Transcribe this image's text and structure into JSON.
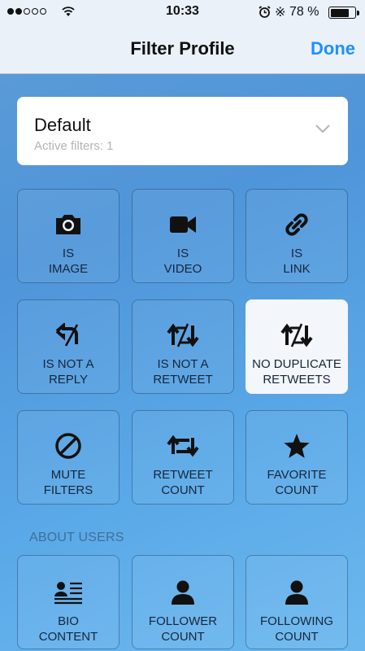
{
  "status_bar": {
    "time": "10:33",
    "battery_percent": "78 %",
    "battery_level": 0.78,
    "signal_bars_filled": 2,
    "signal_bars_total": 5
  },
  "nav": {
    "title": "Filter Profile",
    "done_label": "Done"
  },
  "profile": {
    "name": "Default",
    "subtitle": "Active filters: 1"
  },
  "filters": [
    {
      "id": "image",
      "label": "IS\nIMAGE",
      "icon": "camera-icon",
      "selected": false
    },
    {
      "id": "video",
      "label": "IS\nVIDEO",
      "icon": "video-camera-icon",
      "selected": false
    },
    {
      "id": "link",
      "label": "IS\nLINK",
      "icon": "link-icon",
      "selected": false
    },
    {
      "id": "not-reply",
      "label": "IS NOT A\nREPLY",
      "icon": "reply-crossed-icon",
      "selected": false
    },
    {
      "id": "not-retweet",
      "label": "IS NOT A\nRETWEET",
      "icon": "retweet-crossed-icon",
      "selected": false
    },
    {
      "id": "no-duplicate",
      "label": "NO DUPLICATE\nRETWEETS",
      "icon": "retweet-crossed-icon",
      "selected": true
    },
    {
      "id": "mute",
      "label": "MUTE\nFILTERS",
      "icon": "block-icon",
      "selected": false
    },
    {
      "id": "retweet-count",
      "label": "RETWEET\nCOUNT",
      "icon": "retweet-icon",
      "selected": false
    },
    {
      "id": "favorite-count",
      "label": "FAVORITE\nCOUNT",
      "icon": "star-icon",
      "selected": false
    }
  ],
  "about_users": {
    "header": "ABOUT USERS",
    "filters": [
      {
        "id": "bio",
        "label": "BIO\nCONTENT",
        "icon": "bio-card-icon"
      },
      {
        "id": "follower-count",
        "label": "FOLLOWER\nCOUNT",
        "icon": "person-icon"
      },
      {
        "id": "following-count",
        "label": "FOLLOWING\nCOUNT",
        "icon": "person-icon"
      }
    ]
  },
  "colors": {
    "accent": "#1e90ff",
    "background": "#5aa9e8",
    "tile_text": "#16263a",
    "selected_tile": "#f3f6fa"
  }
}
